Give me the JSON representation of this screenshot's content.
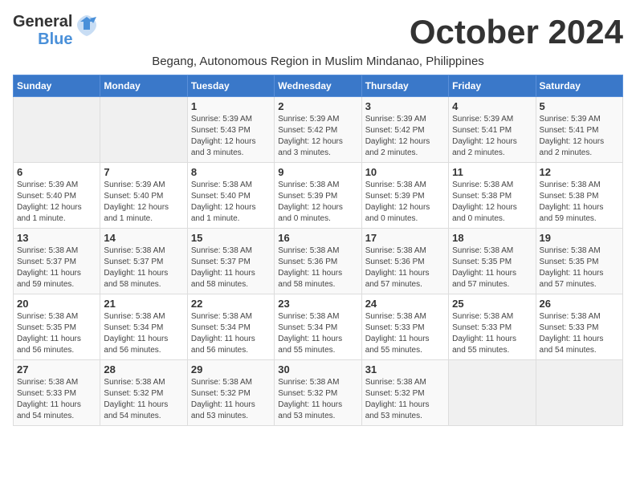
{
  "logo": {
    "part1": "General",
    "part2": "Blue"
  },
  "title": "October 2024",
  "subtitle": "Begang, Autonomous Region in Muslim Mindanao, Philippines",
  "days_header": [
    "Sunday",
    "Monday",
    "Tuesday",
    "Wednesday",
    "Thursday",
    "Friday",
    "Saturday"
  ],
  "weeks": [
    [
      {
        "day": "",
        "info": ""
      },
      {
        "day": "",
        "info": ""
      },
      {
        "day": "1",
        "info": "Sunrise: 5:39 AM\nSunset: 5:43 PM\nDaylight: 12 hours\nand 3 minutes."
      },
      {
        "day": "2",
        "info": "Sunrise: 5:39 AM\nSunset: 5:42 PM\nDaylight: 12 hours\nand 3 minutes."
      },
      {
        "day": "3",
        "info": "Sunrise: 5:39 AM\nSunset: 5:42 PM\nDaylight: 12 hours\nand 2 minutes."
      },
      {
        "day": "4",
        "info": "Sunrise: 5:39 AM\nSunset: 5:41 PM\nDaylight: 12 hours\nand 2 minutes."
      },
      {
        "day": "5",
        "info": "Sunrise: 5:39 AM\nSunset: 5:41 PM\nDaylight: 12 hours\nand 2 minutes."
      }
    ],
    [
      {
        "day": "6",
        "info": "Sunrise: 5:39 AM\nSunset: 5:40 PM\nDaylight: 12 hours\nand 1 minute."
      },
      {
        "day": "7",
        "info": "Sunrise: 5:39 AM\nSunset: 5:40 PM\nDaylight: 12 hours\nand 1 minute."
      },
      {
        "day": "8",
        "info": "Sunrise: 5:38 AM\nSunset: 5:40 PM\nDaylight: 12 hours\nand 1 minute."
      },
      {
        "day": "9",
        "info": "Sunrise: 5:38 AM\nSunset: 5:39 PM\nDaylight: 12 hours\nand 0 minutes."
      },
      {
        "day": "10",
        "info": "Sunrise: 5:38 AM\nSunset: 5:39 PM\nDaylight: 12 hours\nand 0 minutes."
      },
      {
        "day": "11",
        "info": "Sunrise: 5:38 AM\nSunset: 5:38 PM\nDaylight: 12 hours\nand 0 minutes."
      },
      {
        "day": "12",
        "info": "Sunrise: 5:38 AM\nSunset: 5:38 PM\nDaylight: 11 hours\nand 59 minutes."
      }
    ],
    [
      {
        "day": "13",
        "info": "Sunrise: 5:38 AM\nSunset: 5:37 PM\nDaylight: 11 hours\nand 59 minutes."
      },
      {
        "day": "14",
        "info": "Sunrise: 5:38 AM\nSunset: 5:37 PM\nDaylight: 11 hours\nand 58 minutes."
      },
      {
        "day": "15",
        "info": "Sunrise: 5:38 AM\nSunset: 5:37 PM\nDaylight: 11 hours\nand 58 minutes."
      },
      {
        "day": "16",
        "info": "Sunrise: 5:38 AM\nSunset: 5:36 PM\nDaylight: 11 hours\nand 58 minutes."
      },
      {
        "day": "17",
        "info": "Sunrise: 5:38 AM\nSunset: 5:36 PM\nDaylight: 11 hours\nand 57 minutes."
      },
      {
        "day": "18",
        "info": "Sunrise: 5:38 AM\nSunset: 5:35 PM\nDaylight: 11 hours\nand 57 minutes."
      },
      {
        "day": "19",
        "info": "Sunrise: 5:38 AM\nSunset: 5:35 PM\nDaylight: 11 hours\nand 57 minutes."
      }
    ],
    [
      {
        "day": "20",
        "info": "Sunrise: 5:38 AM\nSunset: 5:35 PM\nDaylight: 11 hours\nand 56 minutes."
      },
      {
        "day": "21",
        "info": "Sunrise: 5:38 AM\nSunset: 5:34 PM\nDaylight: 11 hours\nand 56 minutes."
      },
      {
        "day": "22",
        "info": "Sunrise: 5:38 AM\nSunset: 5:34 PM\nDaylight: 11 hours\nand 56 minutes."
      },
      {
        "day": "23",
        "info": "Sunrise: 5:38 AM\nSunset: 5:34 PM\nDaylight: 11 hours\nand 55 minutes."
      },
      {
        "day": "24",
        "info": "Sunrise: 5:38 AM\nSunset: 5:33 PM\nDaylight: 11 hours\nand 55 minutes."
      },
      {
        "day": "25",
        "info": "Sunrise: 5:38 AM\nSunset: 5:33 PM\nDaylight: 11 hours\nand 55 minutes."
      },
      {
        "day": "26",
        "info": "Sunrise: 5:38 AM\nSunset: 5:33 PM\nDaylight: 11 hours\nand 54 minutes."
      }
    ],
    [
      {
        "day": "27",
        "info": "Sunrise: 5:38 AM\nSunset: 5:33 PM\nDaylight: 11 hours\nand 54 minutes."
      },
      {
        "day": "28",
        "info": "Sunrise: 5:38 AM\nSunset: 5:32 PM\nDaylight: 11 hours\nand 54 minutes."
      },
      {
        "day": "29",
        "info": "Sunrise: 5:38 AM\nSunset: 5:32 PM\nDaylight: 11 hours\nand 53 minutes."
      },
      {
        "day": "30",
        "info": "Sunrise: 5:38 AM\nSunset: 5:32 PM\nDaylight: 11 hours\nand 53 minutes."
      },
      {
        "day": "31",
        "info": "Sunrise: 5:38 AM\nSunset: 5:32 PM\nDaylight: 11 hours\nand 53 minutes."
      },
      {
        "day": "",
        "info": ""
      },
      {
        "day": "",
        "info": ""
      }
    ]
  ]
}
